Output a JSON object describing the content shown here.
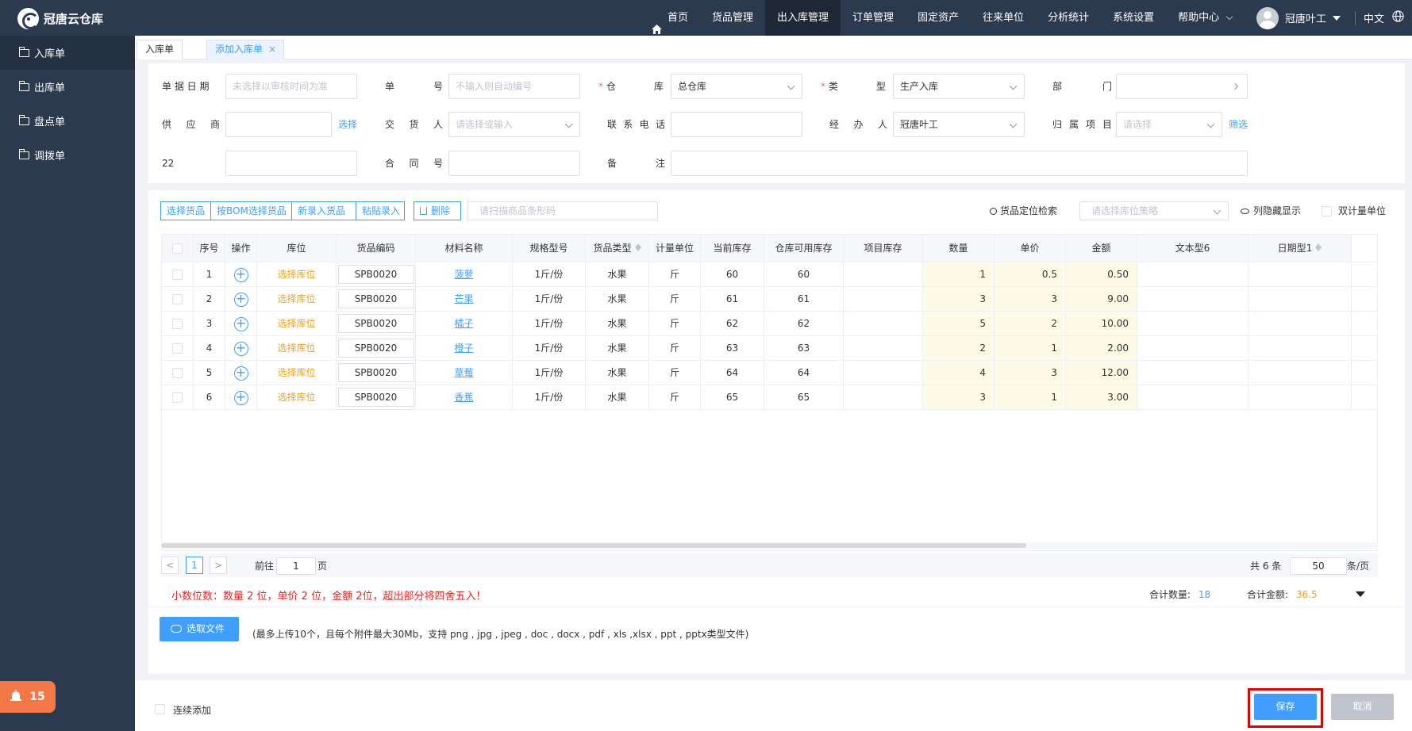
{
  "app": {
    "name": "冠唐云仓库"
  },
  "nav": {
    "items": [
      "首页",
      "货品管理",
      "出入库管理",
      "订单管理",
      "固定资产",
      "往来单位",
      "分析统计",
      "系统设置",
      "帮助中心"
    ],
    "active": "出入库管理"
  },
  "user": {
    "name": "冠唐叶工",
    "lang": "中文"
  },
  "sidebar": {
    "items": [
      "入库单",
      "出库单",
      "盘点单",
      "调拨单"
    ],
    "active": "入库单"
  },
  "alert": {
    "count": "15"
  },
  "tabs": [
    {
      "label": "入库单"
    },
    {
      "label": "添加入库单",
      "close": "×"
    }
  ],
  "form": {
    "date": {
      "label": "单 据 日 期",
      "placeholder": "未选择以审核时间为准"
    },
    "number": {
      "label": "单 号",
      "placeholder": "不输入则自动编号"
    },
    "warehouse": {
      "label": "仓 库",
      "value": "总仓库"
    },
    "type": {
      "label": "类 型",
      "value": "生产入库"
    },
    "dept": {
      "label": "部 门"
    },
    "supplier": {
      "label": "供 应 商",
      "link": "选择"
    },
    "deliverer": {
      "label": "交 货 人",
      "placeholder": "请选择或输入"
    },
    "phone": {
      "label": "联 系 电 话"
    },
    "handler": {
      "label": "经 办 人",
      "value": "冠唐叶工"
    },
    "project": {
      "label": "归 属 项 目",
      "placeholder": "请选择",
      "link": "筛选"
    },
    "custom22": {
      "label": "22"
    },
    "contract": {
      "label": "合 同 号"
    },
    "remark": {
      "label": "备 注"
    }
  },
  "toolbar": {
    "select_goods": "选择货品",
    "bom_select": "按BOM选择货品",
    "new_goods": "新录入货品",
    "paste": "粘贴录入",
    "delete": "删除",
    "scan_placeholder": "请扫描商品条形码",
    "locate_search": "货品定位检索",
    "loc_strategy_placeholder": "请选择库位策略",
    "column_hide": "列隐藏显示",
    "dual_unit": "双计量单位"
  },
  "table": {
    "headers": [
      "序号",
      "操作",
      "库位",
      "货品编码",
      "材料名称",
      "规格型号",
      "货品类型",
      "计量单位",
      "当前库存",
      "仓库可用库存",
      "项目库存",
      "数量",
      "单价",
      "金额",
      "文本型6",
      "日期型1"
    ],
    "rows": [
      {
        "idx": "1",
        "loc": "选择库位",
        "code": "SPB0020",
        "name": "菠萝",
        "spec": "1斤/份",
        "cat": "水果",
        "unit": "斤",
        "stock": "60",
        "avail": "60",
        "proj": "",
        "qty": "1",
        "price": "0.5",
        "amount": "0.50"
      },
      {
        "idx": "2",
        "loc": "选择库位",
        "code": "SPB0020",
        "name": "芒果",
        "spec": "1斤/份",
        "cat": "水果",
        "unit": "斤",
        "stock": "61",
        "avail": "61",
        "proj": "",
        "qty": "3",
        "price": "3",
        "amount": "9.00"
      },
      {
        "idx": "3",
        "loc": "选择库位",
        "code": "SPB0020",
        "name": "橘子",
        "spec": "1斤/份",
        "cat": "水果",
        "unit": "斤",
        "stock": "62",
        "avail": "62",
        "proj": "",
        "qty": "5",
        "price": "2",
        "amount": "10.00"
      },
      {
        "idx": "4",
        "loc": "选择库位",
        "code": "SPB0020",
        "name": "橙子",
        "spec": "1斤/份",
        "cat": "水果",
        "unit": "斤",
        "stock": "63",
        "avail": "63",
        "proj": "",
        "qty": "2",
        "price": "1",
        "amount": "2.00"
      },
      {
        "idx": "5",
        "loc": "选择库位",
        "code": "SPB0020",
        "name": "草莓",
        "spec": "1斤/份",
        "cat": "水果",
        "unit": "斤",
        "stock": "64",
        "avail": "64",
        "proj": "",
        "qty": "4",
        "price": "3",
        "amount": "12.00"
      },
      {
        "idx": "6",
        "loc": "选择库位",
        "code": "SPB0020",
        "name": "香蕉",
        "spec": "1斤/份",
        "cat": "水果",
        "unit": "斤",
        "stock": "65",
        "avail": "65",
        "proj": "",
        "qty": "3",
        "price": "1",
        "amount": "3.00"
      }
    ]
  },
  "pager": {
    "prev": "<",
    "page": "1",
    "next": ">",
    "goto_prefix": "前往",
    "goto_value": "1",
    "goto_suffix": "页",
    "total": "共 6 条",
    "page_size": "50",
    "page_size_suffix": "条/页"
  },
  "summary": {
    "note": "小数位数：数量 2 位，单价 2 位，金额 2位，超出部分将四舍五入！",
    "qty_label": "合计数量:",
    "qty_value": "18",
    "amount_label": "合计金额:",
    "amount_value": "36.5"
  },
  "upload": {
    "button": "选取文件",
    "note": "(最多上传10个，且每个附件最大30Mb，支持 png , jpg , jpeg , doc , docx , pdf , xls ,xlsx , ppt , pptx类型文件)"
  },
  "bottom": {
    "continue_add": "连续添加",
    "save": "保存",
    "cancel": "取消"
  },
  "colors": {
    "primary": "#409eff",
    "nav_bg": "#2c3a4f",
    "required": "#f56c6c",
    "warning": "#f0a020",
    "alert": "#f27848"
  }
}
